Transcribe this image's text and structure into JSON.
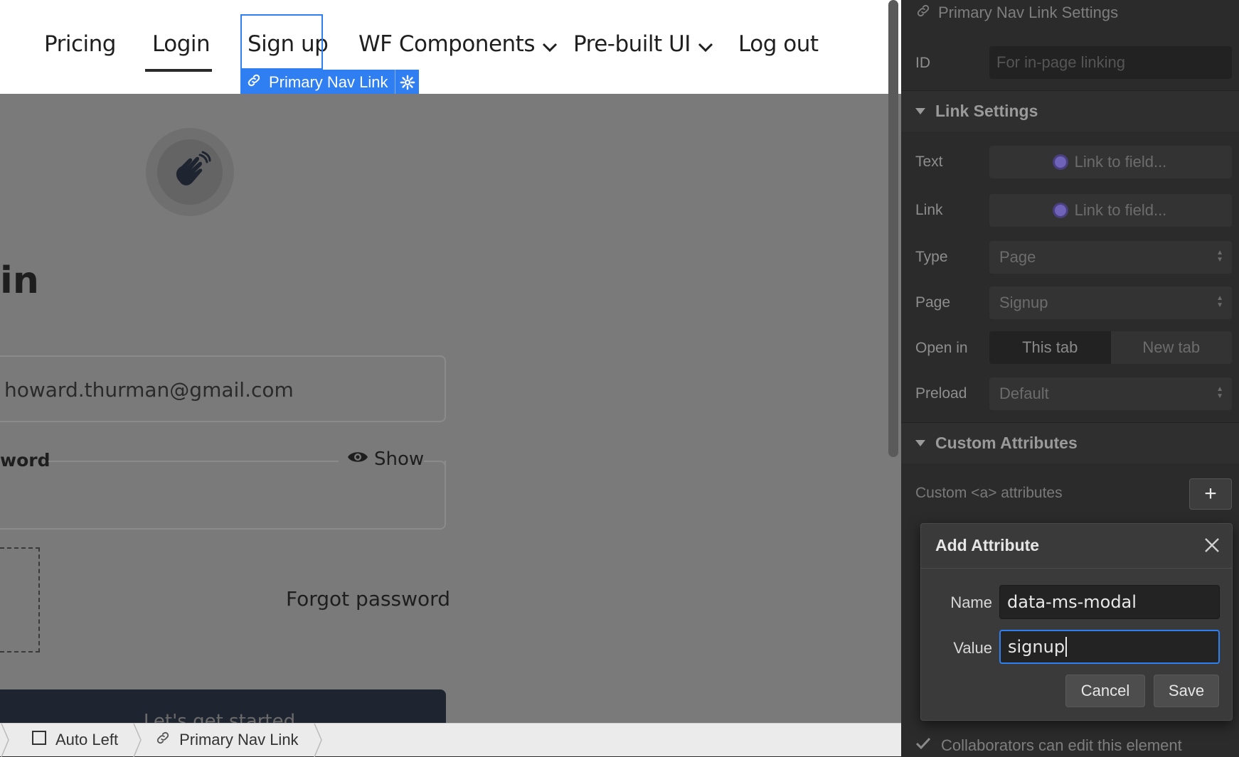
{
  "nav": {
    "pricing": "Pricing",
    "login": "Login",
    "signup": "Sign up",
    "wf_components": "WF Components",
    "prebuilt_ui": "Pre-built UI",
    "logout": "Log out"
  },
  "selection_tag": {
    "label": "Primary Nav Link"
  },
  "canvas": {
    "heading": "in",
    "email_value": "howard.thurman@gmail.com",
    "password_label": "word",
    "show_label": "Show",
    "forgot_password": "Forgot password",
    "cta_label": "Let's get started"
  },
  "breadcrumb": {
    "items": [
      "Auto Left",
      "Primary Nav Link"
    ]
  },
  "panel": {
    "header_title": "Primary Nav Link Settings",
    "id_label": "ID",
    "id_placeholder": "For in-page linking",
    "link_settings_title": "Link Settings",
    "text_label": "Text",
    "text_field": "Link to field...",
    "link_label": "Link",
    "link_field": "Link to field...",
    "type_label": "Type",
    "type_value": "Page",
    "page_label": "Page",
    "page_value": "Signup",
    "open_in_label": "Open in",
    "open_in_options": [
      "This tab",
      "New tab"
    ],
    "preload_label": "Preload",
    "preload_value": "Default",
    "custom_attributes_title": "Custom Attributes",
    "custom_attr_label": "Custom <a> attributes",
    "collab_label": "Collaborators can edit this element"
  },
  "dialog": {
    "title": "Add Attribute",
    "name_label": "Name",
    "name_value": "data-ms-modal",
    "value_label": "Value",
    "value_value": "signup",
    "cancel_label": "Cancel",
    "save_label": "Save"
  },
  "colors": {
    "accent": "#2f7ff2",
    "panel_bg": "#2b2b2b",
    "canvas_overlay": "#7a7a7a",
    "binding_dot": "#6f62b9"
  },
  "icons": [
    "link-icon",
    "gear-icon",
    "chevron-down-icon",
    "eye-icon",
    "hand-wave-icon",
    "close-icon",
    "checkmark-icon",
    "plus-icon",
    "checkbox-icon"
  ]
}
